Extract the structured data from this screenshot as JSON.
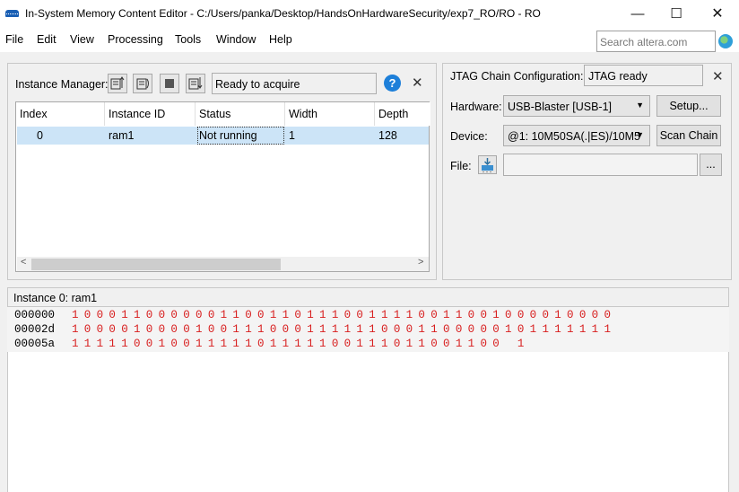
{
  "window": {
    "title": "In-System Memory Content Editor - C:/Users/panka/Desktop/HandsOnHardwareSecurity/exp7_RO/RO - RO",
    "minimize": "—",
    "maximize": "☐",
    "close": "✕"
  },
  "menu": [
    "File",
    "Edit",
    "View",
    "Processing",
    "Tools",
    "Window",
    "Help"
  ],
  "search": {
    "placeholder": "Search altera.com"
  },
  "instance_manager": {
    "label": "Instance Manager:",
    "status": "Ready to acquire",
    "help": "?",
    "close": "✕",
    "columns": [
      "Index",
      "Instance ID",
      "Status",
      "Width",
      "Depth"
    ],
    "rows": [
      {
        "index": "0",
        "instance_id": "ram1",
        "status": "Not running",
        "width": "1",
        "depth": "128"
      }
    ],
    "scroll_left": "<",
    "scroll_right": ">"
  },
  "jtag": {
    "title": "JTAG Chain Configuration:",
    "status": "JTAG ready",
    "close": "✕",
    "hardware_label": "Hardware:",
    "hardware_value": "USB-Blaster [USB-1]",
    "setup_button": "Setup...",
    "device_label": "Device:",
    "device_value": "@1: 10M50SA(.|ES)/10M5",
    "scan_button": "Scan Chain",
    "file_label": "File:",
    "file_value": "",
    "browse_button": "..."
  },
  "memory": {
    "header": "Instance 0: ram1",
    "lines": [
      {
        "addr": "000000",
        "bits": "10001100000011001101110011110011001000010000"
      },
      {
        "addr": "00002d",
        "bits": "10000100001001110001111110001100000101111111"
      },
      {
        "addr": "00005a",
        "bits": "11111001001111101111100111011001100 1"
      }
    ]
  },
  "colors": {
    "selection": "#cce4f7",
    "bits": "#d81e1e",
    "accent": "#1d7fd9"
  }
}
